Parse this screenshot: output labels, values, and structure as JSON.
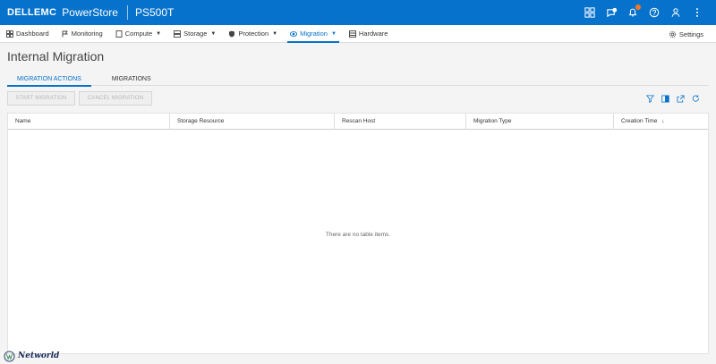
{
  "header": {
    "brand": "DELLEMC",
    "product": "PowerStore",
    "system_name": "PS500T",
    "icons": [
      "grid-icon",
      "chat-icon",
      "bell-icon",
      "help-icon",
      "user-icon",
      "more-icon"
    ],
    "alert_color": "#f47920"
  },
  "nav": {
    "items": [
      {
        "label": "Dashboard",
        "icon": "dashboard-icon",
        "caret": false
      },
      {
        "label": "Monitoring",
        "icon": "flag-icon",
        "caret": false
      },
      {
        "label": "Compute",
        "icon": "compute-icon",
        "caret": true
      },
      {
        "label": "Storage",
        "icon": "storage-icon",
        "caret": true
      },
      {
        "label": "Protection",
        "icon": "shield-icon",
        "caret": true
      },
      {
        "label": "Migration",
        "icon": "migration-icon",
        "caret": true
      },
      {
        "label": "Hardware",
        "icon": "hardware-icon",
        "caret": false
      }
    ],
    "active": "Migration",
    "settings_label": "Settings"
  },
  "page": {
    "title": "Internal Migration",
    "tabs": [
      "MIGRATION ACTIONS",
      "MIGRATIONS"
    ],
    "active_tab": "MIGRATION ACTIONS"
  },
  "toolbar": {
    "start_label": "START MIGRATION",
    "cancel_label": "CANCEL MIGRATION",
    "icons": [
      "filter-icon",
      "columns-icon",
      "export-icon",
      "refresh-icon"
    ]
  },
  "table": {
    "columns": [
      "Name",
      "Storage Resource",
      "Rescan Host",
      "Migration Type",
      "Creation Time"
    ],
    "sort_indicator": "↓",
    "empty_message": "There are no table items."
  },
  "watermark": {
    "text": "Networld"
  },
  "colors": {
    "primary": "#0672cb",
    "disabled_text": "#b5b5b5"
  }
}
